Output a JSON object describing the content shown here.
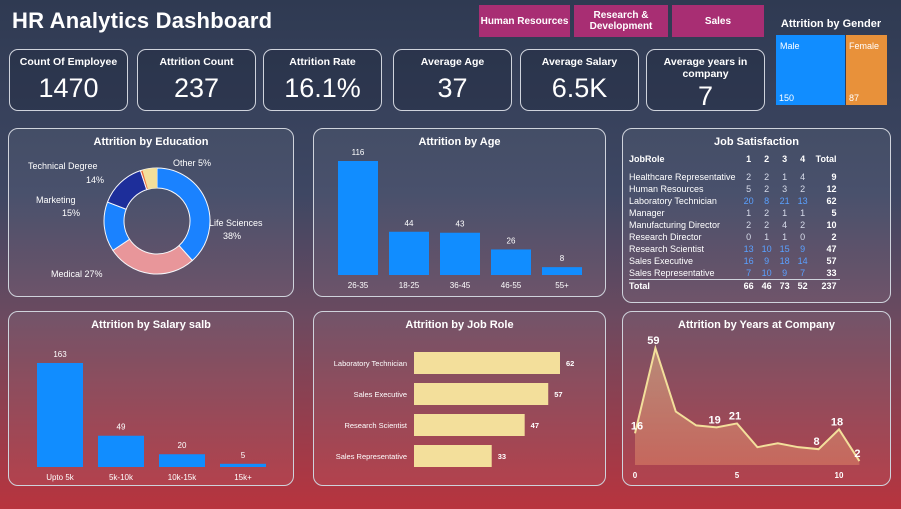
{
  "title": "HR Analytics Dashboard",
  "tabs": [
    "Human Resources",
    "Research & Development",
    "Sales"
  ],
  "kpis": {
    "employee": {
      "label": "Count Of Employee",
      "value": "1470"
    },
    "attrition": {
      "label": "Attrition Count",
      "value": "237"
    },
    "rate": {
      "label": "Attrition Rate",
      "value": "16.1%"
    },
    "age": {
      "label": "Average Age",
      "value": "37"
    },
    "salary": {
      "label": "Average Salary",
      "value": "6.5K"
    },
    "years": {
      "label": "Average years in company",
      "value": "7"
    }
  },
  "gender": {
    "title": "Attrition by Gender",
    "male": {
      "label": "Male",
      "value": "150",
      "color": "#118dff"
    },
    "female": {
      "label": "Female",
      "value": "87",
      "color": "#e8913a"
    }
  },
  "education": {
    "title": "Attrition by Education",
    "chart_data": {
      "type": "pie",
      "categories": [
        "Life Sciences",
        "Medical",
        "Marketing",
        "Technical Degree",
        "Other"
      ],
      "values": [
        38,
        27,
        15,
        14,
        5
      ],
      "colors": [
        "#1a82ff",
        "#e8969a",
        "#1a82ff",
        "#1d2e9a",
        "#ec6a3a"
      ]
    },
    "labels": {
      "life": [
        "Life Sciences",
        "38%"
      ],
      "medical": "Medical 27%",
      "marketing": [
        "Marketing",
        "15%"
      ],
      "technical": [
        "Technical Degree",
        "14%"
      ],
      "other": "Other 5%"
    }
  },
  "age": {
    "title": "Attrition by Age",
    "chart_data": {
      "type": "bar",
      "categories": [
        "26-35",
        "18-25",
        "36-45",
        "46-55",
        "55+"
      ],
      "values": [
        116,
        44,
        43,
        26,
        8
      ]
    }
  },
  "job_satisfaction": {
    "title": "Job Satisfaction",
    "headers": [
      "JobRole",
      "1",
      "2",
      "3",
      "4",
      "Total"
    ],
    "rows": [
      [
        "Healthcare Representative",
        "2",
        "2",
        "1",
        "4",
        "9"
      ],
      [
        "Human Resources",
        "5",
        "2",
        "3",
        "2",
        "12"
      ],
      [
        "Laboratory Technician",
        "20",
        "8",
        "21",
        "13",
        "62"
      ],
      [
        "Manager",
        "1",
        "2",
        "1",
        "1",
        "5"
      ],
      [
        "Manufacturing Director",
        "2",
        "2",
        "4",
        "2",
        "10"
      ],
      [
        "Research Director",
        "0",
        "1",
        "1",
        "0",
        "2"
      ],
      [
        "Research Scientist",
        "13",
        "10",
        "15",
        "9",
        "47"
      ],
      [
        "Sales Executive",
        "16",
        "9",
        "18",
        "14",
        "57"
      ],
      [
        "Sales Representative",
        "7",
        "10",
        "9",
        "7",
        "33"
      ]
    ],
    "total": [
      "Total",
      "66",
      "46",
      "73",
      "52",
      "237"
    ]
  },
  "salary": {
    "title": "Attrition by Salary salb",
    "chart_data": {
      "type": "bar",
      "categories": [
        "Upto 5k",
        "5k-10k",
        "10k-15k",
        "15k+"
      ],
      "values": [
        163,
        49,
        20,
        5
      ]
    }
  },
  "jobrole": {
    "title": "Attrition by Job Role",
    "chart_data": {
      "type": "bar",
      "orientation": "horizontal",
      "categories": [
        "Laboratory Technician",
        "Sales Executive",
        "Research Scientist",
        "Sales Representative"
      ],
      "values": [
        62,
        57,
        47,
        33
      ]
    }
  },
  "years": {
    "title": "Attrition by Years at Company",
    "chart_data": {
      "type": "area",
      "x": [
        0,
        1,
        2,
        3,
        4,
        5,
        6,
        7,
        8,
        9,
        10,
        11
      ],
      "values": [
        16,
        59,
        27,
        20,
        19,
        21,
        9,
        11,
        9,
        8,
        18,
        2
      ],
      "labeled": [
        0,
        1,
        4,
        5,
        9,
        10,
        11
      ],
      "xticks": [
        "0",
        "5",
        "10"
      ]
    }
  },
  "colors": {
    "blue": "#118dff",
    "yellow": "#f3df9b",
    "tab": "#a82e73"
  }
}
